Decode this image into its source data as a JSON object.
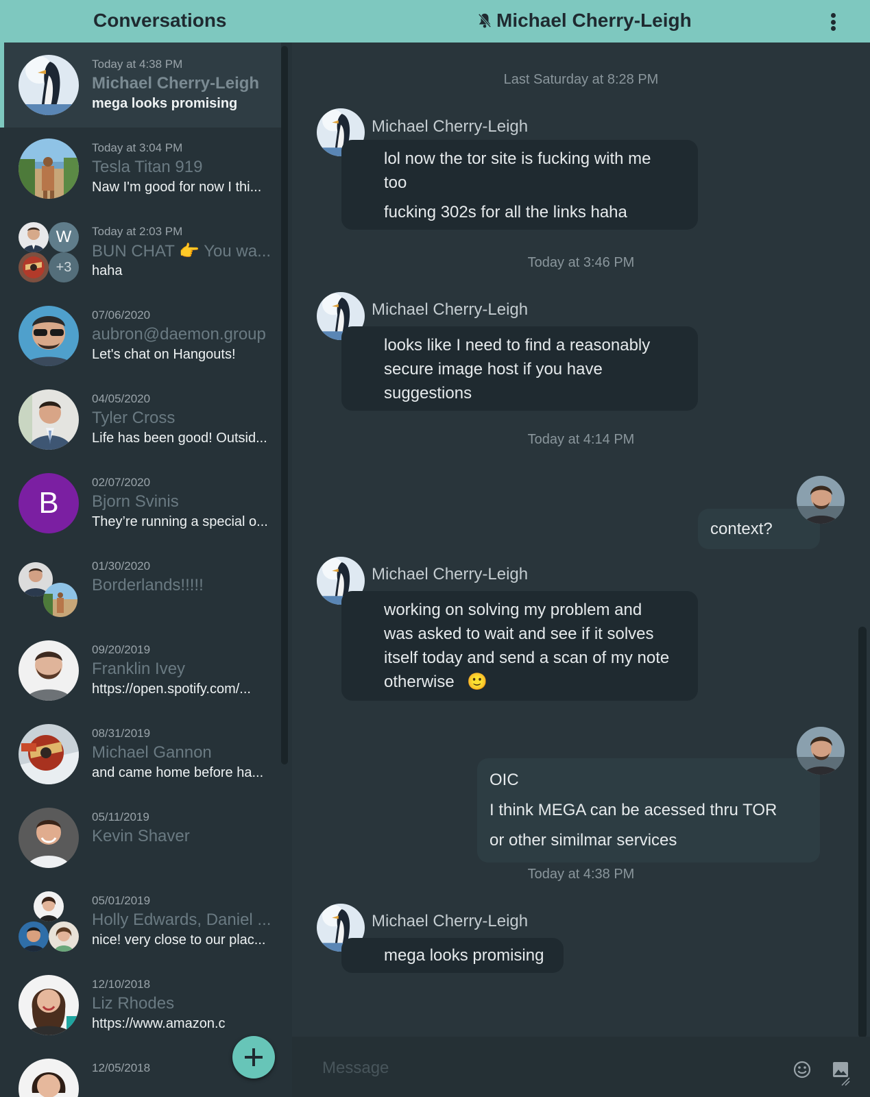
{
  "header": {
    "left_title": "Conversations",
    "chat_title": "Michael Cherry-Leigh",
    "mute_icon": "bell-off-icon",
    "menu_icon": "more-vertical-icon"
  },
  "conversations": [
    {
      "date": "Today at 4:38 PM",
      "name": "Michael Cherry-Leigh",
      "preview": "mega looks promising",
      "avatar": "penguin-photo"
    },
    {
      "date": "Today at 3:04 PM",
      "name": "Tesla Titan 919",
      "preview": "Naw I'm good for now I thi...",
      "avatar": "beach-photo"
    },
    {
      "date": "Today at 2:03 PM",
      "name": "BUN CHAT 👉  You wa...",
      "preview": "haha",
      "avatar_letter": "W",
      "avatar_more": "+3"
    },
    {
      "date": "07/06/2020",
      "name": "aubron@daemon.group",
      "preview": "Let's chat on Hangouts!",
      "avatar": "sunglasses-photo"
    },
    {
      "date": "04/05/2020",
      "name": "Tyler Cross",
      "preview": "Life has been good! Outsid...",
      "avatar": "suit-photo"
    },
    {
      "date": "02/07/2020",
      "name": "Bjorn Svinis",
      "preview": "They’re running a special o...",
      "avatar_letter": "B"
    },
    {
      "date": "01/30/2020",
      "name": "Borderlands!!!!!",
      "preview": "",
      "avatar": "group-photo"
    },
    {
      "date": "09/20/2019",
      "name": "Franklin Ivey",
      "preview": "https://open.spotify.com/...",
      "avatar": "beard-photo"
    },
    {
      "date": "08/31/2019",
      "name": "Michael Gannon",
      "preview": "and came home before ha...",
      "avatar": "helmet-photo"
    },
    {
      "date": "05/11/2019",
      "name": "Kevin Shaver",
      "preview": "",
      "avatar": "man-photo"
    },
    {
      "date": "05/01/2019",
      "name": "Holly Edwards, Daniel ...",
      "preview": "nice! very close to our plac...",
      "avatar": "group-photo"
    },
    {
      "date": "12/10/2018",
      "name": "Liz Rhodes",
      "preview": "https://www.amazon.c",
      "avatar": "woman-photo"
    },
    {
      "date": "12/05/2018",
      "name": "",
      "preview": "",
      "avatar": "woman-photo"
    }
  ],
  "fab_icon": "plus-icon",
  "chat": {
    "separators": [
      "Last Saturday at 8:28 PM",
      "Today at 3:46 PM",
      "Today at 4:14 PM",
      "Today at 4:38 PM"
    ],
    "sender": "Michael Cherry-Leigh",
    "messages": [
      {
        "lines": [
          "lol now the tor site is fucking with me",
          "too",
          "fucking 302s for all the links haha"
        ]
      },
      {
        "lines": [
          "looks like I need to find a reasonably",
          "secure image host if you have",
          "suggestions"
        ]
      },
      {
        "lines": [
          "context?"
        ]
      },
      {
        "lines": [
          "working on solving my problem and",
          "was asked to wait and see if it solves",
          "itself today and send a scan of my note",
          "otherwise "
        ],
        "emoji": "🙂"
      },
      {
        "lines": [
          "OIC",
          "I think MEGA can be acessed thru TOR",
          "or other similmar services"
        ]
      },
      {
        "lines": [
          "mega looks promising"
        ]
      }
    ]
  },
  "composer": {
    "placeholder": "Message",
    "emoji_icon": "emoji-icon",
    "image_icon": "image-icon"
  }
}
